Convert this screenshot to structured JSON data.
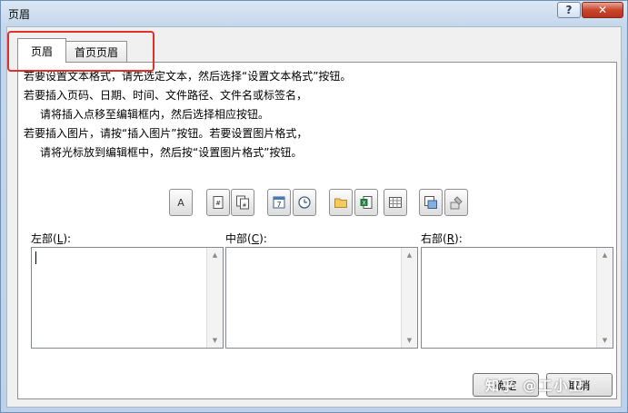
{
  "window": {
    "title": "页眉",
    "help_label": "?",
    "close_label": "✕"
  },
  "tabs": [
    {
      "label": "页眉",
      "active": true
    },
    {
      "label": "首页页眉",
      "active": false
    }
  ],
  "instructions": [
    "若要设置文本格式，请先选定文本，然后选择“设置文本格式”按钮。",
    "若要插入页码、日期、时间、文件路径、文件名或标签名，",
    "请将插入点移至编辑框内，然后选择相应按钮。",
    "若要插入图片，请按“插入图片”按钮。若要设置图片格式，",
    "请将光标放到编辑框中，然后按“设置图片格式”按钮。"
  ],
  "toolbar": [
    {
      "name": "format-text-button",
      "icon": "font-a-icon",
      "glyph": "A"
    },
    {
      "name": "insert-page-number-button",
      "icon": "page-number-icon"
    },
    {
      "name": "insert-page-count-button",
      "icon": "page-count-icon"
    },
    {
      "name": "insert-date-button",
      "icon": "calendar-icon",
      "glyph": "7"
    },
    {
      "name": "insert-time-button",
      "icon": "clock-icon"
    },
    {
      "name": "insert-file-path-button",
      "icon": "folder-icon"
    },
    {
      "name": "insert-file-name-button",
      "icon": "excel-file-icon"
    },
    {
      "name": "insert-sheet-name-button",
      "icon": "sheet-grid-icon"
    },
    {
      "name": "insert-picture-button",
      "icon": "picture-icon"
    },
    {
      "name": "format-picture-button",
      "icon": "paint-icon"
    }
  ],
  "sections": {
    "left": {
      "label": "左部(",
      "key": "L",
      "suffix": "):"
    },
    "center": {
      "label": "中部(",
      "key": "C",
      "suffix": "):"
    },
    "right": {
      "label": "右部(",
      "key": "R",
      "suffix": "):"
    }
  },
  "scroll": {
    "up": "▲",
    "down": "▼"
  },
  "buttons": {
    "ok": "确定",
    "cancel": "取消"
  },
  "watermark": "知乎 @工小卫",
  "colors": {
    "highlight": "#e0302a",
    "title_gradient": "#c6d7eb"
  }
}
